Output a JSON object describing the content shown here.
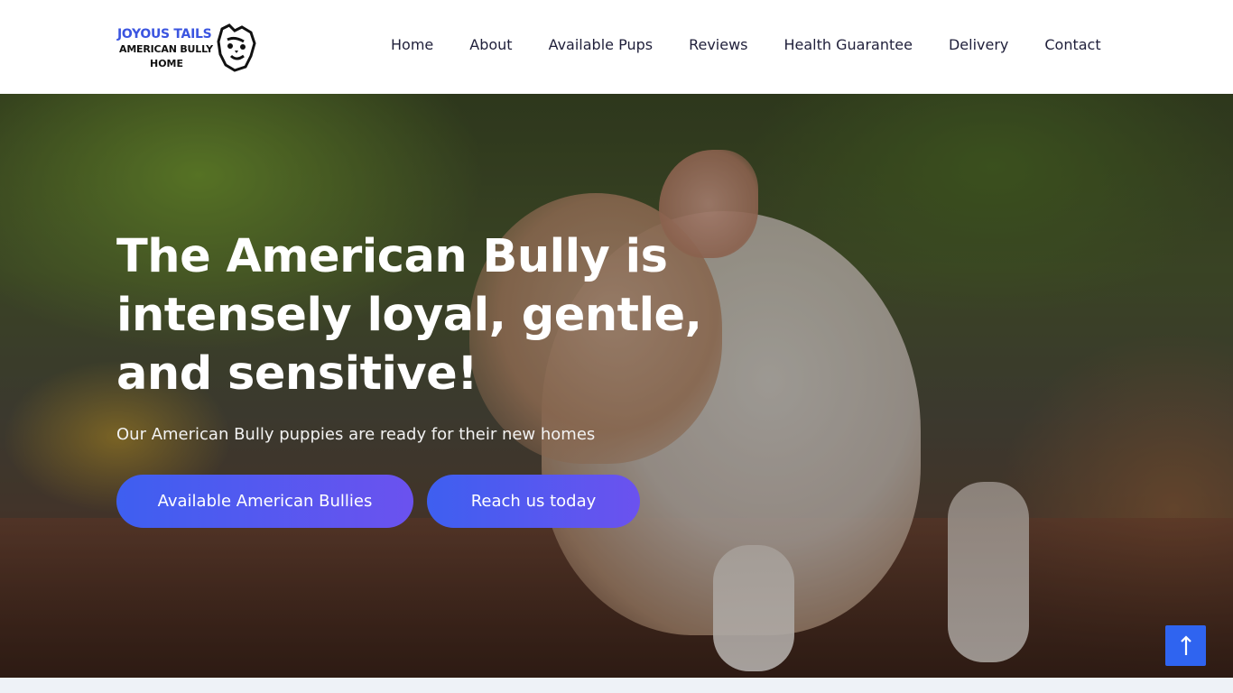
{
  "brand": {
    "line1": "JOYOUS TAILS",
    "line2": "AMERICAN BULLY",
    "line3": "HOME"
  },
  "nav": {
    "items": [
      "Home",
      "About",
      "Available Pups",
      "Reviews",
      "Health Guarantee",
      "Delivery",
      "Contact"
    ]
  },
  "hero": {
    "title": "The American Bully is intensely loyal, gentle, and sensitive!",
    "subtitle": "Our American Bully puppies are ready for their new homes",
    "primary_button": "Available American Bullies",
    "secondary_button": "Reach us today"
  },
  "icons": {
    "logo_mark": "bulldog-head-icon",
    "scroll_top": "arrow-up-icon"
  },
  "colors": {
    "accent_start": "#3e5ff0",
    "accent_end": "#6b52ef",
    "brand_blue": "#3b55e0",
    "scroll_button": "#2f64f0"
  }
}
